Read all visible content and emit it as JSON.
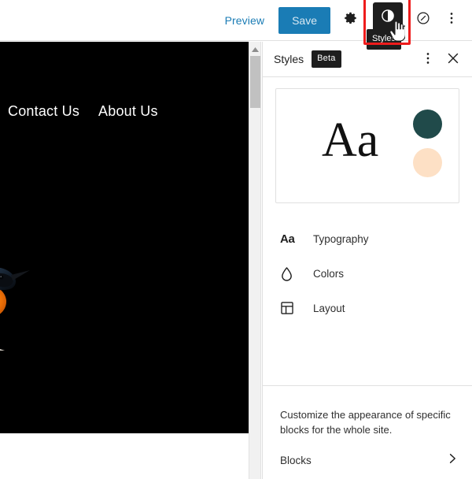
{
  "toolbar": {
    "preview_label": "Preview",
    "save_label": "Save",
    "settings_icon": "gear-icon",
    "styles_icon": "contrast-half-circle-icon",
    "styles_tooltip": "Styles",
    "navigation_icon": "compass-slash-circle-icon",
    "more_icon": "three-dots-vertical-icon",
    "highlight_color": "#ee1c1c",
    "accent_color": "#1a7cb5"
  },
  "canvas": {
    "background_color": "#000000",
    "nav_links": [
      {
        "label": "Contact Us"
      },
      {
        "label": "About Us"
      }
    ],
    "image_alt": "bird-photo"
  },
  "scrollbar": {
    "up_arrow_icon": "caret-up-icon",
    "thumb_color": "#c1c1c1"
  },
  "sidebar": {
    "title": "Styles",
    "badge": "Beta",
    "more_icon": "three-dots-vertical-icon",
    "close_icon": "close-x-icon",
    "preview": {
      "sample_text": "Aa",
      "primary_color": "#204a4a",
      "secondary_color": "#fde0c5"
    },
    "items": [
      {
        "label": "Typography",
        "icon": "aa-typography-icon",
        "glyph": "Aa"
      },
      {
        "label": "Colors",
        "icon": "droplet-icon"
      },
      {
        "label": "Layout",
        "icon": "layout-grid-icon"
      }
    ],
    "footer": {
      "description": "Customize the appearance of specific blocks for the whole site.",
      "blocks_label": "Blocks",
      "chevron_icon": "chevron-right-icon"
    }
  }
}
